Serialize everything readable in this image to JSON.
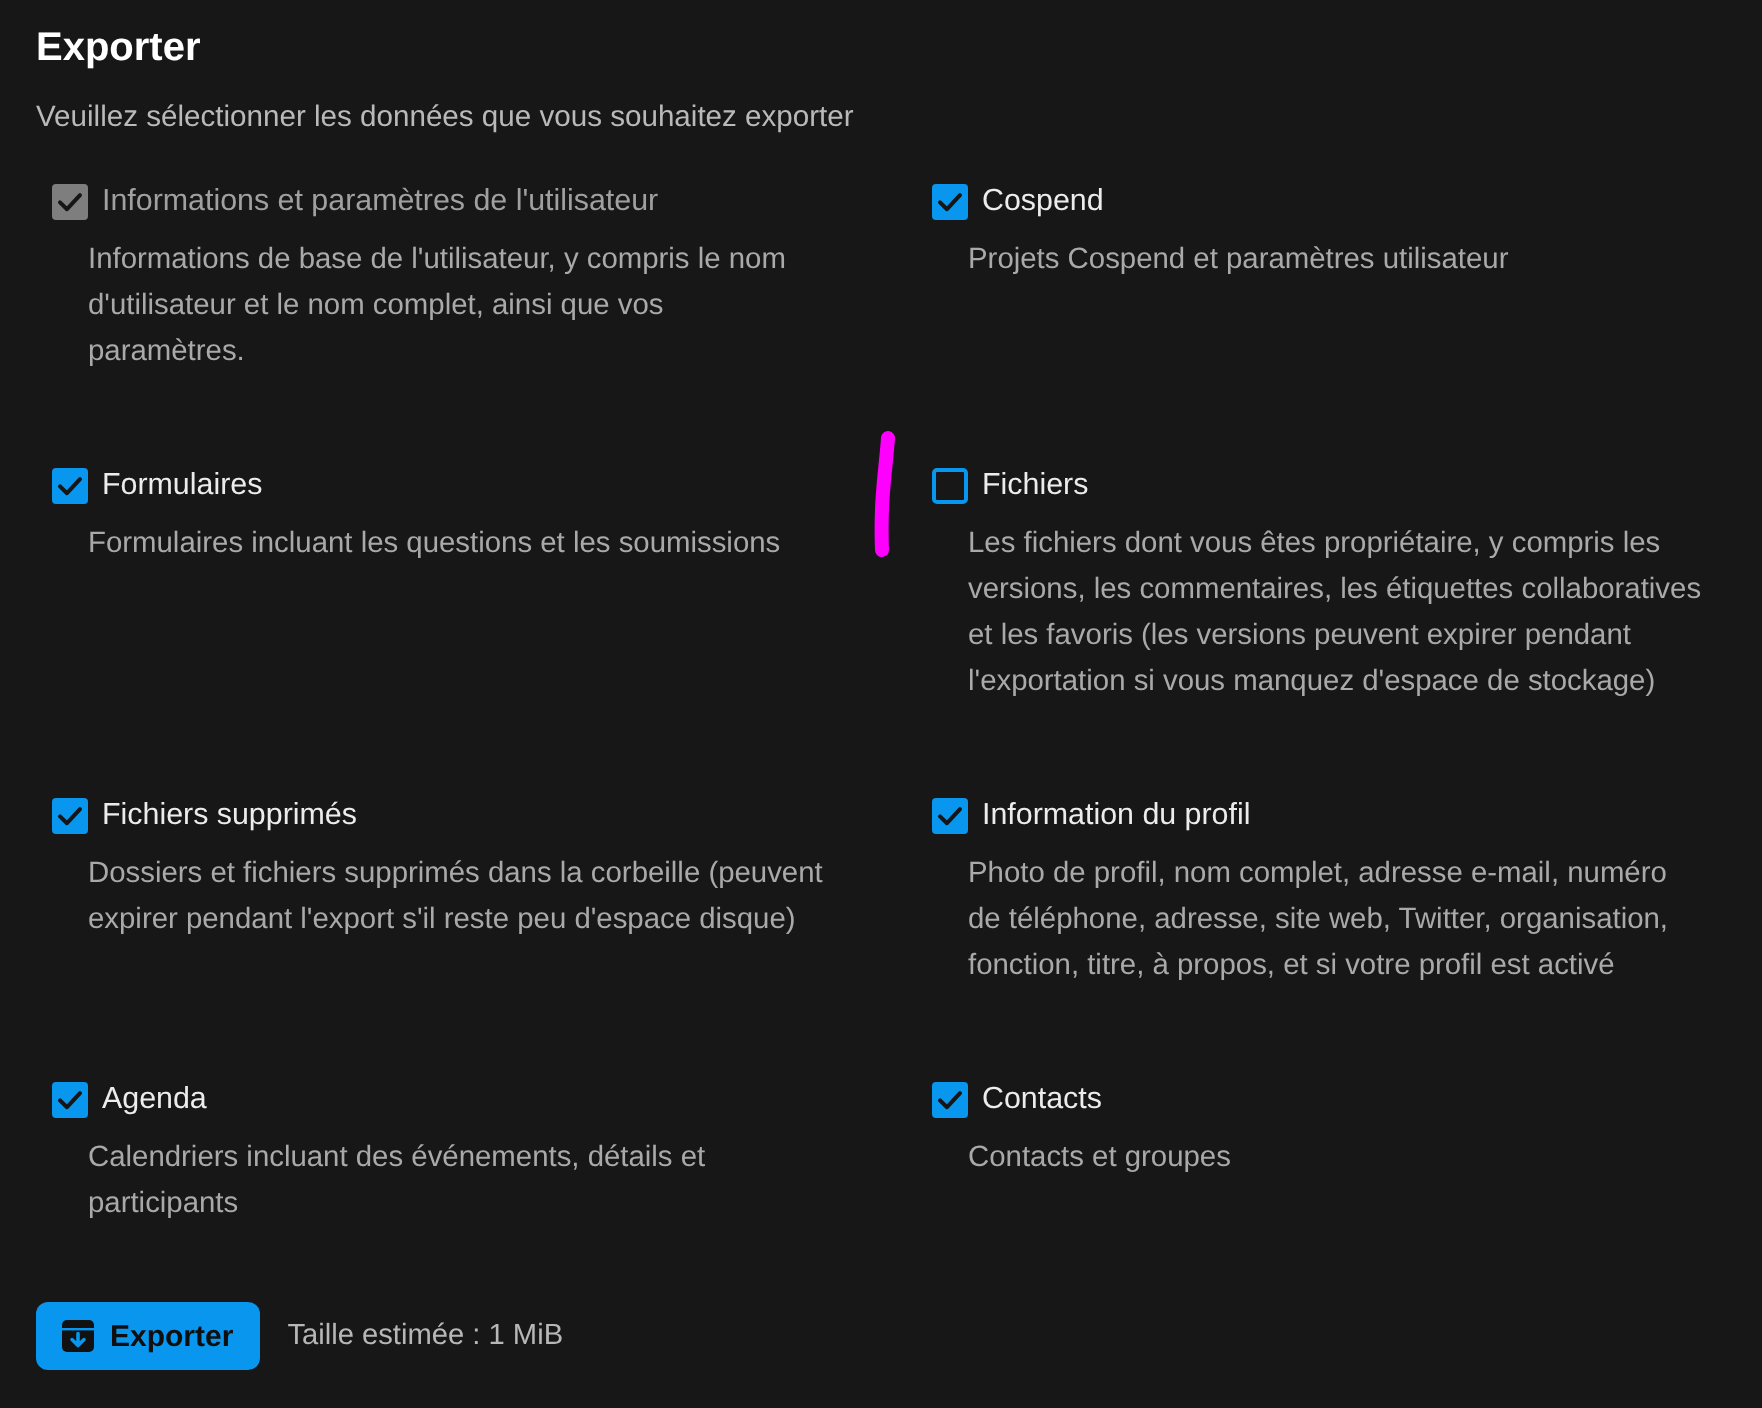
{
  "title": "Exporter",
  "subtitle": "Veuillez sélectionner les données que vous souhaitez exporter",
  "options": [
    {
      "label": "Informations et paramètres de l'utilisateur",
      "description": "Informations de base de l'utilisateur, y compris le nom\nd'utilisateur et le nom complet, ainsi que vos\nparamètres.",
      "checked": true,
      "disabled": true
    },
    {
      "label": "Cospend",
      "description": "Projets Cospend et paramètres utilisateur",
      "checked": true,
      "disabled": false
    },
    {
      "label": "Formulaires",
      "description": "Formulaires incluant les questions et les soumissions",
      "checked": true,
      "disabled": false
    },
    {
      "label": "Fichiers",
      "description": "Les fichiers dont vous êtes propriétaire, y compris les\nversions, les commentaires, les étiquettes collaboratives\net les favoris (les versions peuvent expirer pendant\nl'exportation si vous manquez d'espace de stockage)",
      "checked": false,
      "disabled": false
    },
    {
      "label": "Fichiers supprimés",
      "description": "Dossiers et fichiers supprimés dans la corbeille (peuvent\nexpirer pendant l'export s'il reste peu d'espace disque)",
      "checked": true,
      "disabled": false
    },
    {
      "label": "Information du profil",
      "description": "Photo de profil, nom complet, adresse e-mail, numéro\nde téléphone, adresse, site web, Twitter, organisation,\nfonction, titre, à propos, et si votre profil est activé",
      "checked": true,
      "disabled": false
    },
    {
      "label": "Agenda",
      "description": "Calendriers incluant des événements, détails et\nparticipants",
      "checked": true,
      "disabled": false
    },
    {
      "label": "Contacts",
      "description": "Contacts et groupes",
      "checked": true,
      "disabled": false
    }
  ],
  "export_button": {
    "label": "Exporter"
  },
  "size_estimate": "Taille estimée : 1 MiB"
}
